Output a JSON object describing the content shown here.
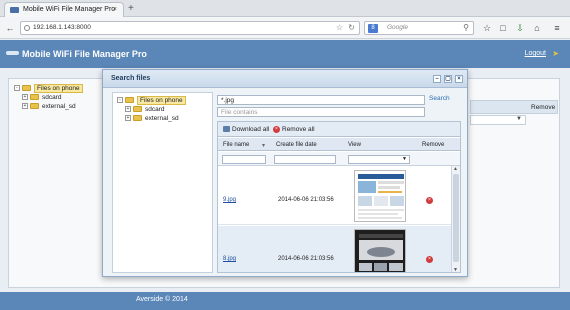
{
  "browser": {
    "tab_title": "Mobile WiFi File Manager Pro",
    "tab_close": "×",
    "new_tab": "+",
    "url": "192.168.1.143:8000",
    "search_placeholder": "Google",
    "search_engine_letter": "8",
    "icons": [
      "back-icon",
      "globe-icon",
      "star-icon",
      "reload-icon",
      "search-icon",
      "bookmark-icon",
      "download-icon",
      "home-icon",
      "menu-icon"
    ]
  },
  "app": {
    "title": "Mobile WiFi File Manager Pro",
    "logout": "Logout",
    "footer": "Averside © 2014",
    "brand_color": "#5a86b8"
  },
  "left_tree": {
    "root": "Files on phone",
    "children": [
      "sdcard",
      "external_sd"
    ]
  },
  "background_table": {
    "remove_header": "Remove"
  },
  "modal": {
    "title": "Search files",
    "controls": [
      "minimize",
      "maximize",
      "close"
    ],
    "tree": {
      "root": "Files on phone",
      "children": [
        "sdcard",
        "external_sd"
      ]
    },
    "search_value": "*.jpg",
    "contains_placeholder": "File contains",
    "search_button": "Search",
    "toolbar": {
      "download_all": "Download all",
      "remove_all": "Remove all"
    },
    "columns": {
      "name": "File name",
      "date": "Create file date",
      "view": "View",
      "remove": "Remove"
    },
    "rows": [
      {
        "name": "9.jpg",
        "date": "2014-06-06 21:03:56"
      },
      {
        "name": "8.jpg",
        "date": "2014-06-06 21:03:56"
      }
    ]
  }
}
